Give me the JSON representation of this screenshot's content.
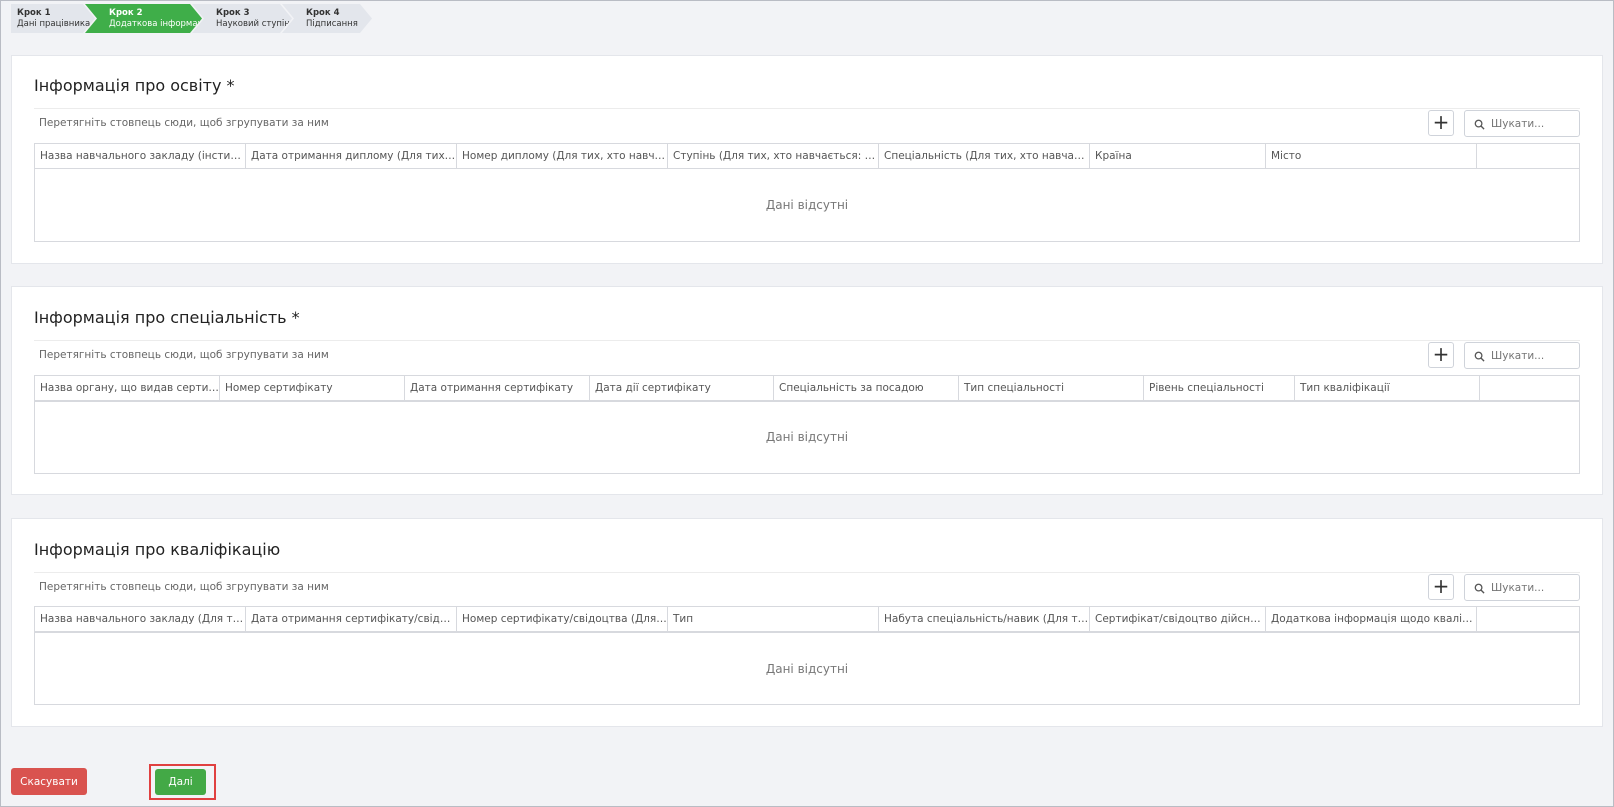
{
  "stepper": {
    "steps": [
      {
        "num": "Крок 1",
        "label": "Дані працівника"
      },
      {
        "num": "Крок 2",
        "label": "Додаткова інформація"
      },
      {
        "num": "Крок 3",
        "label": "Науковий ступінь"
      },
      {
        "num": "Крок 4",
        "label": "Підписання"
      }
    ],
    "active_index": 1,
    "active_color": "#3fae49"
  },
  "common": {
    "group_hint": "Перетягніть стовпець сюди, щоб згрупувати за ним",
    "add_label": "+",
    "search_placeholder": "Шукати...",
    "no_data": "Дані відсутні"
  },
  "education": {
    "title": "Інформація про освіту *",
    "columns": [
      "Назва навчального закладу (інституції) (...",
      "Дата отримання диплому (Для тих, хто н...",
      "Номер диплому (Для тих, хто навчається...",
      "Ступінь (Для тих, хто навчається: ступінь,...",
      "Спеціальність (Для тих, хто навчається: с...",
      "Країна",
      "Місто"
    ]
  },
  "specialty": {
    "title": "Інформація про спеціальність *",
    "columns": [
      "Назва органу, що видав сертифікат",
      "Номер сертифікату",
      "Дата отримання сертифікату",
      "Дата дії сертифікату",
      "Спеціальність за посадою",
      "Тип спеціальності",
      "Рівень спеціальності",
      "Тип кваліфікації"
    ]
  },
  "qualification": {
    "title": "Інформація про кваліфікацію",
    "columns": [
      "Назва навчального закладу (Для тих, хто ...",
      "Дата отримання сертифікату/свідоцтва н...",
      "Номер сертифікату/свідоцтва (Для тих, х...",
      "Тип",
      "Набута спеціальність/навик (Для тих, хто...",
      "Сертифікат/свідоцтво дійсний до",
      "Додаткова інформація щодо кваліфікації"
    ]
  },
  "footer": {
    "cancel_label": "Скасувати",
    "next_label": "Далі",
    "cancel_color": "#d9534f",
    "next_color": "#43a946",
    "highlight_color": "#e04040"
  }
}
